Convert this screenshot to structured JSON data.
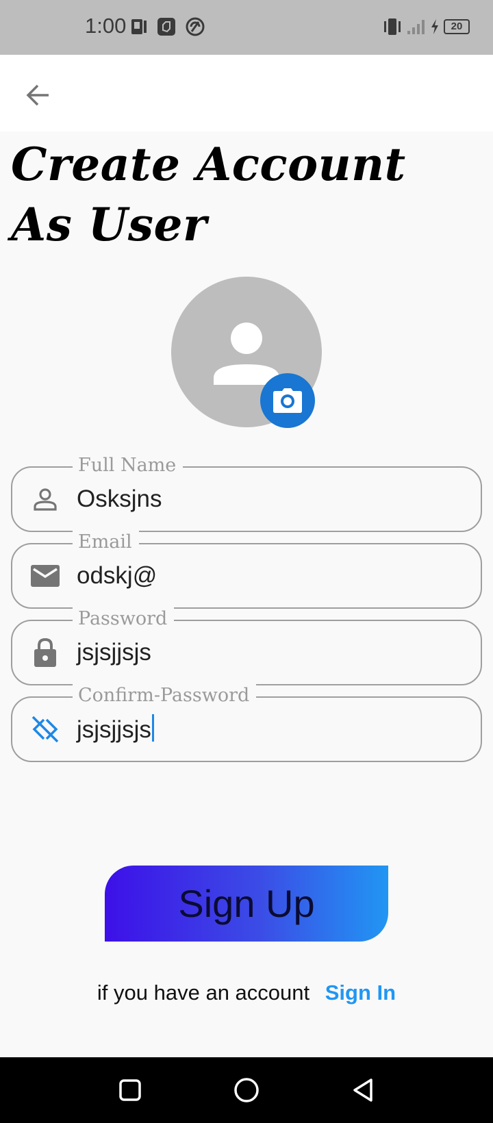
{
  "status_bar": {
    "time": "1:00",
    "battery": "20",
    "left_icons": [
      "notification-icon",
      "app-icon",
      "sync-icon"
    ],
    "right_icons": [
      "vibrate-icon",
      "signal-icon",
      "charging-icon",
      "battery-icon"
    ]
  },
  "app_bar": {
    "back_icon": "arrow-back-icon"
  },
  "page": {
    "title": "Create Account As User"
  },
  "avatar": {
    "icon": "person-icon",
    "camera_icon": "camera-icon"
  },
  "form": {
    "full_name": {
      "label": "Full Name",
      "value": "Osksjns",
      "icon": "person-outline-icon"
    },
    "email": {
      "label": "Email",
      "value": "odskj@",
      "icon": "email-icon"
    },
    "password": {
      "label": "Password",
      "value": "jsjsjjsjs",
      "icon": "lock-icon"
    },
    "confirm_password": {
      "label": "Confirm-Password",
      "value": "jsjsjjsjs",
      "icon": "password-off-icon"
    }
  },
  "signup_button": {
    "label": "Sign Up"
  },
  "footer": {
    "text": "if you have an account",
    "link": "Sign In"
  },
  "colors": {
    "accent": "#1976d2",
    "link": "#2196f3",
    "gradient_start": "#3d10e8",
    "gradient_end": "#2196f3",
    "avatar_bg": "#bdbdbd"
  },
  "nav_bar": {
    "icons": [
      "recent-apps-icon",
      "home-icon",
      "back-nav-icon"
    ]
  }
}
